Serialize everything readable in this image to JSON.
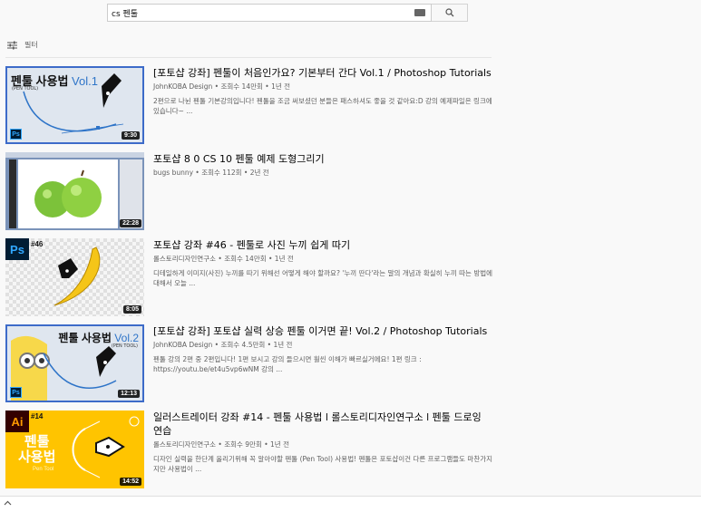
{
  "search": {
    "query": "cs 펜툴"
  },
  "filter": {
    "label": "필터"
  },
  "results": [
    {
      "title": "[포토샵 강좌] 펜툴이 처음인가요? 기본부터 간다 Vol.1 / Photoshop Tutorials",
      "meta": "JohnKOBA Design • 조회수 14만회 • 1년 전",
      "desc": "2편으로 나뉜 펜툴 기본강의입니다! 펜툴을 조금 써보셨던 분들은 패스하셔도 좋을 것 같아요:D 강의 예제파일은 링크에 있습니다~ ...",
      "duration": "9:30",
      "thumb_title": "펜툴 사용법",
      "thumb_vol": "Vol.1",
      "thumb_sub": "(PEN TOOL)",
      "thumb_badge": "Ps"
    },
    {
      "title": "포토샵 8 0 CS 10 펜툴 예제 도형그리기",
      "meta": "bugs bunny • 조회수 112회 • 2년 전",
      "desc": "",
      "duration": "22:28"
    },
    {
      "title": "포토샵 강좌 #46 - 펜툴로 사진 누끼 쉽게 따기",
      "meta": "롤스토리디자인연구소 • 조회수 14만회 • 1년 전",
      "desc": "디테일하게 이미지(사진) 누끼를 따기 위해선 어떻게 해야 할까요? '누끼 딴다'라는 말의 개념과 확실히 누끼 따는 방법에 대해서 오늘 ...",
      "duration": "8:05",
      "thumb_badge": "Ps",
      "thumb_num": "#46"
    },
    {
      "title": "[포토샵 강좌] 포토샵 실력 상승 펜툴 이거면 끝! Vol.2 / Photoshop Tutorials",
      "meta": "JohnKOBA Design • 조회수 4.5만회 • 1년 전",
      "desc": "펜툴 강의 2편 중 2편입니다! 1편 보시고 강의 들으시면 훨씬 이해가 빠르실거에요! 1편 링크 : https://youtu.be/et4u5vp6wNM 강의 ...",
      "duration": "12:13",
      "thumb_title": "펜툴 사용법",
      "thumb_vol": "Vol.2",
      "thumb_sub": "(PEN TOOL)",
      "thumb_badge": "Ps"
    },
    {
      "title": "일러스트레이터 강좌 #14 - 펜툴 사용법 l 롤스토리디자인연구소 l 펜툴 드로잉 연습",
      "meta": "롤스토리디자인연구소 • 조회수 9만회 • 1년 전",
      "desc": "디자인 실력을 한단계 올리기위해 꼭 알아야할 펜툴 (Pen Tool) 사용법! 펜툴은 포토샵이건 다른 프로그램들도 마찬가지지만 사용법이 ...",
      "duration": "14:52",
      "thumb_badge": "Ai",
      "thumb_num": "#14",
      "thumb_big1": "펜툴",
      "thumb_big2": "사용법",
      "thumb_small": "Pen Tool"
    }
  ],
  "colors": {
    "accent": "#3d6bc9",
    "meta": "#606060",
    "illustrator_bg": "#ffc400"
  }
}
